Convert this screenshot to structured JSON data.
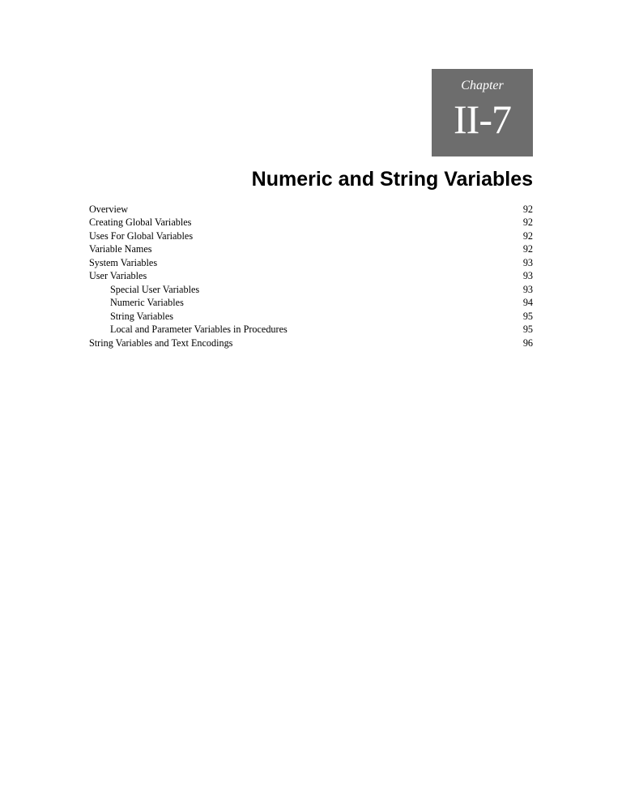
{
  "chapter": {
    "label": "Chapter",
    "number": "II-7"
  },
  "title": "Numeric and String Variables",
  "toc": [
    {
      "label": "Overview",
      "page": "92",
      "indent": false
    },
    {
      "label": "Creating Global Variables",
      "page": "92",
      "indent": false
    },
    {
      "label": "Uses For Global Variables",
      "page": "92",
      "indent": false
    },
    {
      "label": "Variable Names",
      "page": "92",
      "indent": false
    },
    {
      "label": "System Variables",
      "page": "93",
      "indent": false
    },
    {
      "label": "User Variables",
      "page": "93",
      "indent": false
    },
    {
      "label": "Special User Variables",
      "page": "93",
      "indent": true
    },
    {
      "label": "Numeric Variables",
      "page": "94",
      "indent": true
    },
    {
      "label": "String Variables",
      "page": "95",
      "indent": true
    },
    {
      "label": "Local and Parameter Variables in Procedures",
      "page": "95",
      "indent": true
    },
    {
      "label": "String Variables and Text Encodings",
      "page": "96",
      "indent": false
    }
  ]
}
